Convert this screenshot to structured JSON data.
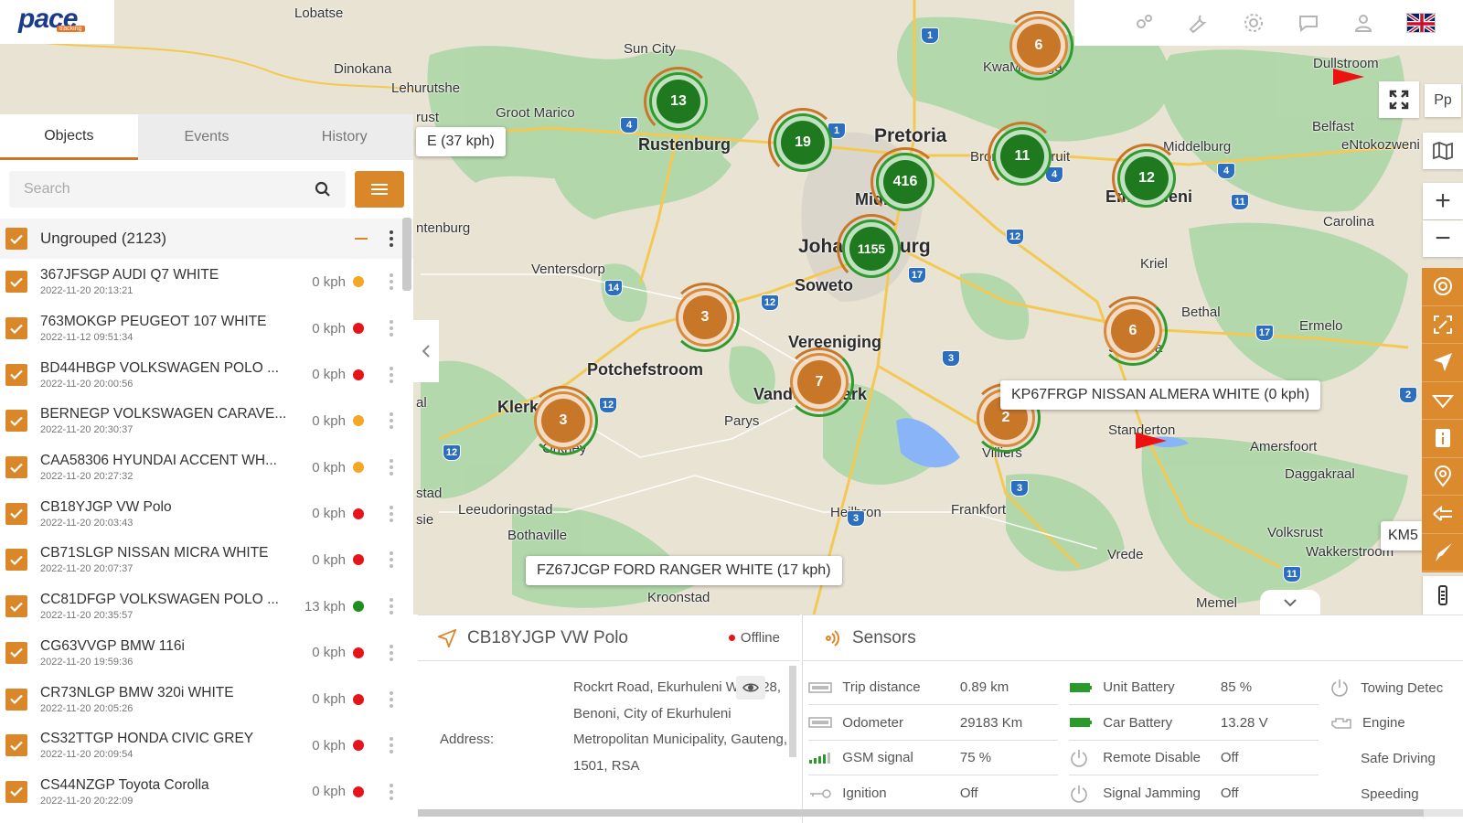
{
  "app": {
    "logo_text": "pace",
    "logo_sub": "tracking"
  },
  "topbar": {
    "icons": [
      "gears-icon",
      "wrench-icon",
      "settings-icon",
      "chat-icon",
      "user-icon"
    ],
    "language_flag": "uk-flag-icon"
  },
  "tabs": [
    {
      "label": "Objects",
      "active": true
    },
    {
      "label": "Events",
      "active": false
    },
    {
      "label": "History",
      "active": false
    }
  ],
  "search": {
    "placeholder": "Search",
    "value": ""
  },
  "group": {
    "label": "Ungrouped (2123)"
  },
  "vehicles": [
    {
      "name": "367JFSGP AUDI Q7 WHITE",
      "time": "2022-11-20 20:13:21",
      "speed": "0 kph",
      "status_color": "#f5a623"
    },
    {
      "name": "763MOKGP PEUGEOT 107 WHITE",
      "time": "2022-11-12 09:51:34",
      "speed": "0 kph",
      "status_color": "#e5141b"
    },
    {
      "name": "BD44HBGP VOLKSWAGEN POLO ...",
      "time": "2022-11-20 20:00:56",
      "speed": "0 kph",
      "status_color": "#e5141b"
    },
    {
      "name": "BERNEGP VOLKSWAGEN CARAVE...",
      "time": "2022-11-20 20:30:37",
      "speed": "0 kph",
      "status_color": "#f5a623"
    },
    {
      "name": "CAA58306 HYUNDAI ACCENT WH...",
      "time": "2022-11-20 20:27:32",
      "speed": "0 kph",
      "status_color": "#f5a623"
    },
    {
      "name": "CB18YJGP VW Polo",
      "time": "2022-11-20 20:03:43",
      "speed": "0 kph",
      "status_color": "#e5141b"
    },
    {
      "name": "CB71SLGP NISSAN MICRA WHITE",
      "time": "2022-11-20 20:07:37",
      "speed": "0 kph",
      "status_color": "#e5141b"
    },
    {
      "name": "CC81DFGP VOLKSWAGEN POLO ...",
      "time": "2022-11-20 20:35:57",
      "speed": "13 kph",
      "status_color": "#1e8e1e"
    },
    {
      "name": "CG63VVGP BMW 116i",
      "time": "2022-11-20 19:59:36",
      "speed": "0 kph",
      "status_color": "#e5141b"
    },
    {
      "name": "CR73NLGP BMW 320i WHITE",
      "time": "2022-11-20 20:05:26",
      "speed": "0 kph",
      "status_color": "#e5141b"
    },
    {
      "name": "CS32TTGP HONDA CIVIC GREY",
      "time": "2022-11-20 20:09:54",
      "speed": "0 kph",
      "status_color": "#e5141b"
    },
    {
      "name": "CS44NZGP Toyota Corolla",
      "time": "2022-11-20 20:22:09",
      "speed": "0 kph",
      "status_color": "#e5141b"
    }
  ],
  "map": {
    "places": [
      "Lobatse",
      "Dinokana",
      "Lehurutshe",
      "Groot Marico",
      "Sun City",
      "Rustenburg",
      "Pretoria",
      "Midrand",
      "Johannesburg",
      "Soweto",
      "Ventersdorp",
      "Potchefstroom",
      "Vereeniging",
      "Vanderbijlpark",
      "Parys",
      "Orkney",
      "Klerksdorp",
      "Leeudoringstad",
      "Bothaville",
      "Heilbron",
      "Frankfort",
      "Villiers",
      "Kroonstad",
      "KwaMhlanga",
      "Dullstroom",
      "Belfast",
      "eNtokozweni",
      "Middelburg",
      "Emalahleni",
      "Bronkhorstspruit",
      "Carolina",
      "Kriel",
      "Bethal",
      "Ermelo",
      "Secunda",
      "Standerton",
      "Amersfoort",
      "Daggakraal",
      "Volksrust",
      "Wakkerstroom",
      "Vrede",
      "Memel",
      "ntenburg",
      "stad",
      "sie",
      "al",
      "rust"
    ],
    "clusters": [
      {
        "count": "13",
        "color": "green"
      },
      {
        "count": "19",
        "color": "green"
      },
      {
        "count": "416",
        "color": "green"
      },
      {
        "count": "1155",
        "color": "green"
      },
      {
        "count": "11",
        "color": "green"
      },
      {
        "count": "12",
        "color": "green"
      },
      {
        "count": "6",
        "color": "orange"
      },
      {
        "count": "3",
        "color": "orange"
      },
      {
        "count": "7",
        "color": "orange"
      },
      {
        "count": "3",
        "color": "orange"
      },
      {
        "count": "6",
        "color": "orange"
      },
      {
        "count": "2",
        "color": "orange"
      }
    ],
    "shields": [
      "1",
      "4",
      "1",
      "4",
      "4",
      "11",
      "12",
      "17",
      "12",
      "14",
      "3",
      "12",
      "12",
      "17",
      "3",
      "3",
      "11",
      "2"
    ],
    "labels": {
      "speed_partial": "E (37 kph)",
      "kp67": "KP67FRGP NISSAN ALMERA WHITE (0 kph)",
      "fz67": "FZ67JCGP FORD RANGER WHITE (17 kph)",
      "km5": "KM5",
      "pp": "Pp"
    }
  },
  "controls": {
    "fullscreen": "fullscreen-icon",
    "layers": "map-layers-icon",
    "zoom_in": "+",
    "zoom_out": "−",
    "rail": [
      "target-icon",
      "fit-bounds-icon",
      "navigate-icon",
      "route-icon",
      "info-icon",
      "pin-icon",
      "history-icon",
      "send-icon",
      "device-icon"
    ]
  },
  "detail": {
    "title": "CB18YJGP VW Polo",
    "status": "Offline",
    "status_color": "#e5141b",
    "address_label": "Address:",
    "address": "Rockrt Road, Ekurhuleni Ward 28, Benoni, City of Ekurhuleni Metropolitan Municipality, Gauteng, 1501, RSA"
  },
  "sensors": {
    "title": "Sensors",
    "col1": [
      {
        "name": "Trip distance",
        "value": "0.89 km",
        "icon": "odometer-icon"
      },
      {
        "name": "Odometer",
        "value": "29183 Km",
        "icon": "odometer-icon"
      },
      {
        "name": "GSM signal",
        "value": "75 %",
        "icon": "signal-icon"
      },
      {
        "name": "Ignition",
        "value": "Off",
        "icon": "key-icon"
      }
    ],
    "col2": [
      {
        "name": "Unit Battery",
        "value": "85 %",
        "icon": "battery-icon"
      },
      {
        "name": "Car Battery",
        "value": "13.28 V",
        "icon": "battery-icon"
      },
      {
        "name": "Remote Disable",
        "value": "Off",
        "icon": "power-icon"
      },
      {
        "name": "Signal Jamming",
        "value": "Off",
        "icon": "power-icon"
      }
    ],
    "col3": [
      {
        "name": "Towing Detec",
        "icon": "power-icon"
      },
      {
        "name": "Engine",
        "icon": "engine-icon"
      },
      {
        "name": "Safe Driving",
        "icon": ""
      },
      {
        "name": "Speeding",
        "icon": ""
      }
    ]
  }
}
